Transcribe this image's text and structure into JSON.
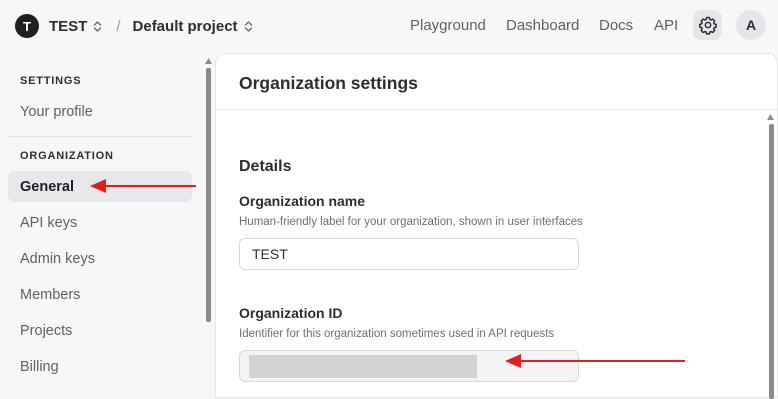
{
  "topbar": {
    "org_initial": "T",
    "org_name": "TEST",
    "separator": "/",
    "project_name": "Default project",
    "nav": [
      "Playground",
      "Dashboard",
      "Docs",
      "API"
    ],
    "user_initial": "A"
  },
  "sidebar": {
    "settings_heading": "SETTINGS",
    "your_profile": "Your profile",
    "organization_heading": "ORGANIZATION",
    "items": [
      "General",
      "API keys",
      "Admin keys",
      "Members",
      "Projects",
      "Billing"
    ],
    "active_item": "General"
  },
  "panel": {
    "title": "Organization settings",
    "section": "Details",
    "org_name_label": "Organization name",
    "org_name_help": "Human-friendly label for your organization, shown in user interfaces",
    "org_name_value": "TEST",
    "org_id_label": "Organization ID",
    "org_id_help": "Identifier for this organization sometimes used in API requests"
  },
  "colors": {
    "annotation_arrow": "#e0201b",
    "active_item_bg": "#e8e8ec"
  }
}
